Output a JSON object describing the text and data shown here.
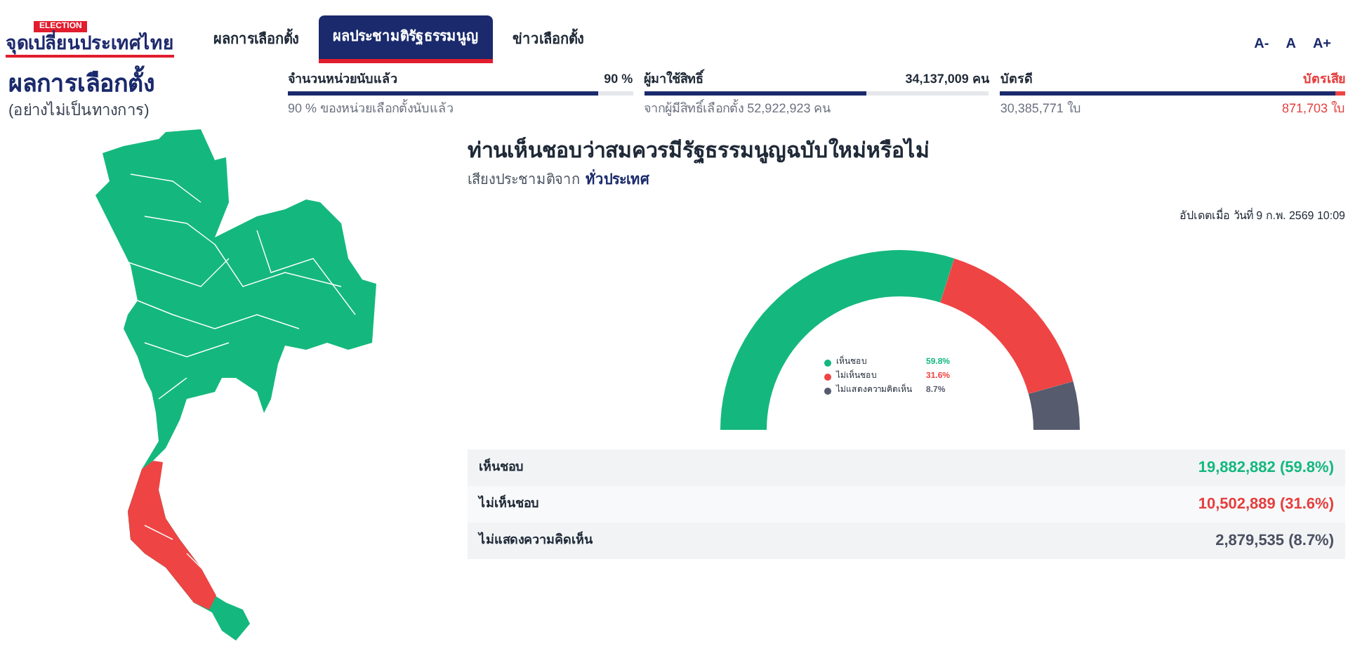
{
  "logo": {
    "badge": "ELECTION",
    "title": "จุดเปลี่ยนประเทศไทย"
  },
  "tabs": [
    {
      "label": "ผลการเลือกตั้ง",
      "selected": false
    },
    {
      "label": "ผลประชามติรัฐธรรมนูญ",
      "selected": true
    },
    {
      "label": "ข่าวเลือกตั้ง",
      "selected": false
    }
  ],
  "font_size_buttons": [
    "A-",
    "A",
    "A+"
  ],
  "page_title": "ผลการเลือกตั้ง",
  "page_subtitle": "(อย่างไม่เป็นทางการ)",
  "stats": [
    {
      "kind": "single",
      "label": "จำนวนหน่วยนับแล้ว",
      "value": "90 %",
      "note": "90 % ของหน่วยเลือกตั้งนับแล้ว",
      "level": 0.9
    },
    {
      "kind": "single",
      "label": "ผู้มาใช้สิทธิ์",
      "value": "34,137,009 คน",
      "note": "จากผู้มีสิทธิ์เลือกตั้ง 52,922,923 คน",
      "level": 0.645
    },
    {
      "kind": "split",
      "label": "บัตรดี",
      "value": "บัตรเสีย",
      "note": "30,385,771 ใบ",
      "note_right": "871,703 ใบ",
      "level": 0.972
    }
  ],
  "question": "ท่านเห็นชอบว่าสมควรมีรัฐธรรมนูญฉบับใหม่หรือไม่",
  "scope_label": "เสียงประชามติจาก",
  "scope_value": "ทั่วประเทศ",
  "updated": "อัปเดตเมื่อ วันที่ 9 ก.พ. 2569 10:09",
  "chart_data": {
    "type": "donut",
    "categories": [
      "เห็นชอบ",
      "ไม่เห็นชอบ",
      "ไม่แสดงความคิดเห็น"
    ],
    "values": [
      59.8,
      31.6,
      8.7
    ]
  },
  "legend": [
    {
      "value": "59.8%",
      "color": "#14b87e"
    },
    {
      "value": "31.6%",
      "color": "#ef4444"
    },
    {
      "value": "8.7%",
      "color": "#565b6e"
    }
  ],
  "results": [
    {
      "label": "เห็นชอบ",
      "value": "19,882,882 (59.8%)",
      "color": "#14b87e"
    },
    {
      "label": "ไม่เห็นชอบ",
      "value": "10,502,889 (31.6%)",
      "color": "#e53e3e"
    },
    {
      "label": "ไม่แสดงความคิดเห็น",
      "value": "2,879,535 (8.7%)",
      "color": "#4b5060"
    }
  ]
}
